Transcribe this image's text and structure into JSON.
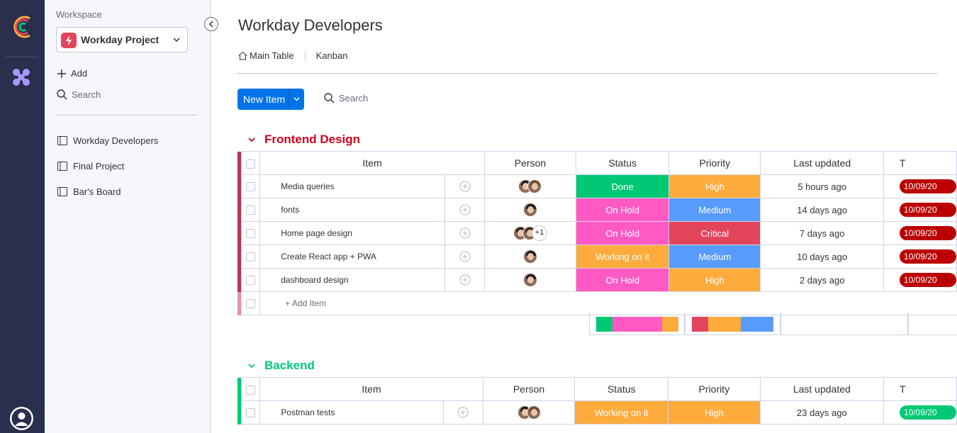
{
  "workspace": {
    "label": "Workspace",
    "name": "Workday Project"
  },
  "sidebar": {
    "add_label": "Add",
    "search_label": "Search",
    "boards": [
      {
        "label": "Workday Developers"
      },
      {
        "label": "Final Project"
      },
      {
        "label": "Bar's Board"
      }
    ]
  },
  "board": {
    "title": "Workday Developers",
    "views": [
      "Main Table",
      "Kanban"
    ],
    "new_item_label": "New Item",
    "search_label": "Search"
  },
  "columns": {
    "item": "Item",
    "person": "Person",
    "status": "Status",
    "priority": "Priority",
    "last_updated": "Last updated",
    "timeline": "T"
  },
  "colors": {
    "done": "#00c875",
    "on_hold": "#ff5ac4",
    "working": "#fdab3d",
    "high": "#fdab3d",
    "medium": "#579bfc",
    "critical": "#e2445c",
    "frontend": "#bb3354",
    "backend": "#00c875",
    "timeline_red": "#bb0000"
  },
  "groups": [
    {
      "name": "Frontend Design",
      "color": "#d0021b",
      "add_item_label": "+ Add Item",
      "rows": [
        {
          "item": "Media queries",
          "status": "Done",
          "status_color": "#00c875",
          "priority": "High",
          "priority_color": "#fdab3d",
          "last": "5 hours ago",
          "timeline": "10/09/20",
          "extra": ""
        },
        {
          "item": "fonts",
          "status": "On Hold",
          "status_color": "#ff5ac4",
          "priority": "Medium",
          "priority_color": "#579bfc",
          "last": "14 days ago",
          "timeline": "10/09/20",
          "extra": ""
        },
        {
          "item": "Home page design",
          "status": "On Hold",
          "status_color": "#ff5ac4",
          "priority": "Critical",
          "priority_color": "#e2445c",
          "last": "7 days ago",
          "timeline": "10/09/20",
          "extra": "+1"
        },
        {
          "item": "Create React app + PWA",
          "status": "Working on it",
          "status_color": "#fdab3d",
          "priority": "Medium",
          "priority_color": "#579bfc",
          "last": "10 days ago",
          "timeline": "10/09/20",
          "extra": ""
        },
        {
          "item": "dashboard design",
          "status": "On Hold",
          "status_color": "#ff5ac4",
          "priority": "High",
          "priority_color": "#fdab3d",
          "last": "2 days ago",
          "timeline": "10/09/20",
          "extra": ""
        }
      ],
      "status_summary": [
        0.2,
        0.6,
        0.2
      ],
      "priority_summary": [
        0.2,
        0.4,
        0.4
      ]
    },
    {
      "name": "Backend",
      "color": "#00c875",
      "rows": [
        {
          "item": "Postman tests",
          "status": "Working on it",
          "status_color": "#fdab3d",
          "priority": "High",
          "priority_color": "#fdab3d",
          "last": "23 days ago",
          "timeline": "10/09/20",
          "extra": ""
        }
      ]
    }
  ]
}
